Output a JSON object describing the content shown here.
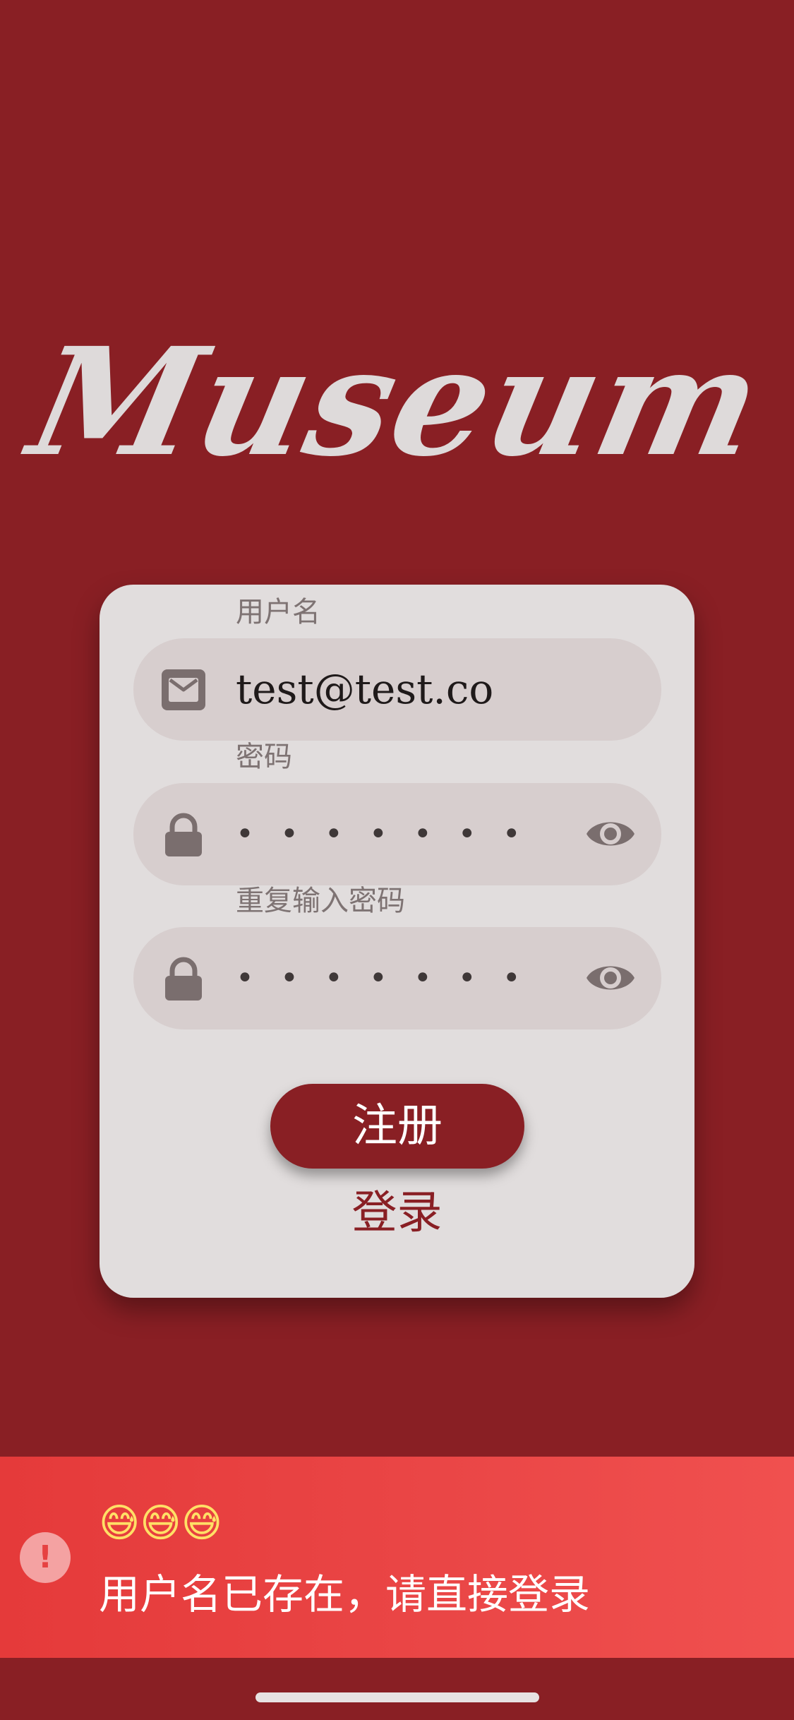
{
  "app": {
    "logo_text": "Museum"
  },
  "form": {
    "username": {
      "label": "用户名",
      "value": "test@test.co",
      "icon": "mail-icon"
    },
    "password": {
      "label": "密码",
      "masked_value": "•••••••",
      "icon": "lock-icon",
      "toggle_icon": "eye-icon"
    },
    "repeat_password": {
      "label": "重复输入密码",
      "masked_value": "•••••••",
      "icon": "lock-icon",
      "toggle_icon": "eye-icon"
    },
    "register_button": "注册",
    "login_link": "登录"
  },
  "toast": {
    "icon": "alert-icon",
    "icon_glyph": "!",
    "emoji": "😅😅😅",
    "message": "用户名已存在，请直接登录"
  },
  "colors": {
    "background": "#891F24",
    "card": "#E1DDDD",
    "field": "#D7CECE",
    "toast": "#E53A3A",
    "logo": "#DEDADA"
  }
}
